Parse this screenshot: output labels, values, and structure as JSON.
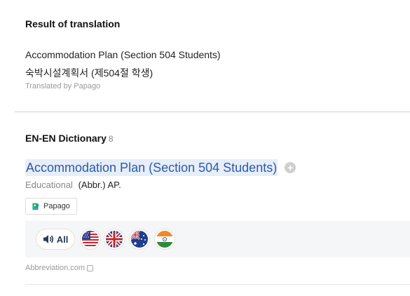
{
  "translation": {
    "heading": "Result of translation",
    "source_text": "Accommodation Plan (Section 504 Students)",
    "translated_text": "숙박시설계획서 (제504절 학생)",
    "credit": "Translated by Papago"
  },
  "dictionary": {
    "heading": "EN-EN Dictionary",
    "count": "8",
    "entry": {
      "headword": "Accommodation Plan (Section 504 Students)",
      "add_icon": "plus-circle-icon",
      "category": "Educational",
      "definition": "(Abbr.) AP."
    },
    "papago_button": {
      "label": "Papago",
      "icon": "papago-logo-icon"
    },
    "audio": {
      "all_label": "All",
      "all_icon": "speaker-icon",
      "flags": [
        "us-flag-icon",
        "uk-flag-icon",
        "australia-flag-icon",
        "india-flag-icon"
      ]
    },
    "source": {
      "label": "Abbreviation.com",
      "icon": "checkbox-icon"
    }
  },
  "colors": {
    "headword": "#2d5aa8",
    "headword_highlight": "#e6eef9",
    "muted_text": "#999999",
    "audio_bar_bg": "#f5f6f7"
  }
}
